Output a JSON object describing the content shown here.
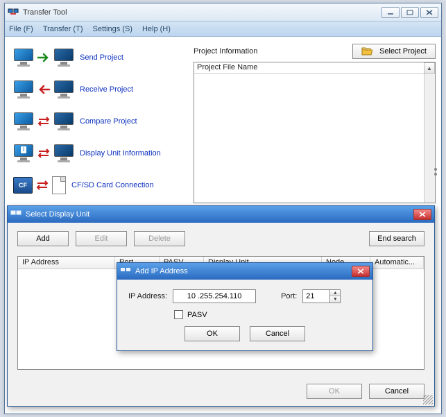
{
  "window": {
    "title": "Transfer Tool",
    "menus": {
      "file": "File (F)",
      "transfer": "Transfer (T)",
      "settings": "Settings (S)",
      "help": "Help (H)"
    }
  },
  "actions": {
    "send": "Send Project",
    "receive": "Receive Project",
    "compare": "Compare Project",
    "unitinfo": "Display Unit Information",
    "cfsd": "CF/SD Card Connection"
  },
  "projectInfo": {
    "label": "Project Information",
    "selectBtn": "Select Project",
    "columnHeader": "Project File Name"
  },
  "selectDisplay": {
    "title": "Select Display Unit",
    "add": "Add",
    "edit": "Edit",
    "delete": "Delete",
    "endSearch": "End search",
    "cols": {
      "ip": "IP Address",
      "port": "Port",
      "pasv": "PASV",
      "unit": "Display Unit",
      "node": "Node",
      "auto": "Automatic..."
    },
    "ok": "OK",
    "cancel": "Cancel"
  },
  "addIp": {
    "title": "Add IP Address",
    "ipLabel": "IP Address:",
    "ipValue": "10 .255.254.110",
    "portLabel": "Port:",
    "portValue": "21",
    "pasv": "PASV",
    "ok": "OK",
    "cancel": "Cancel"
  }
}
